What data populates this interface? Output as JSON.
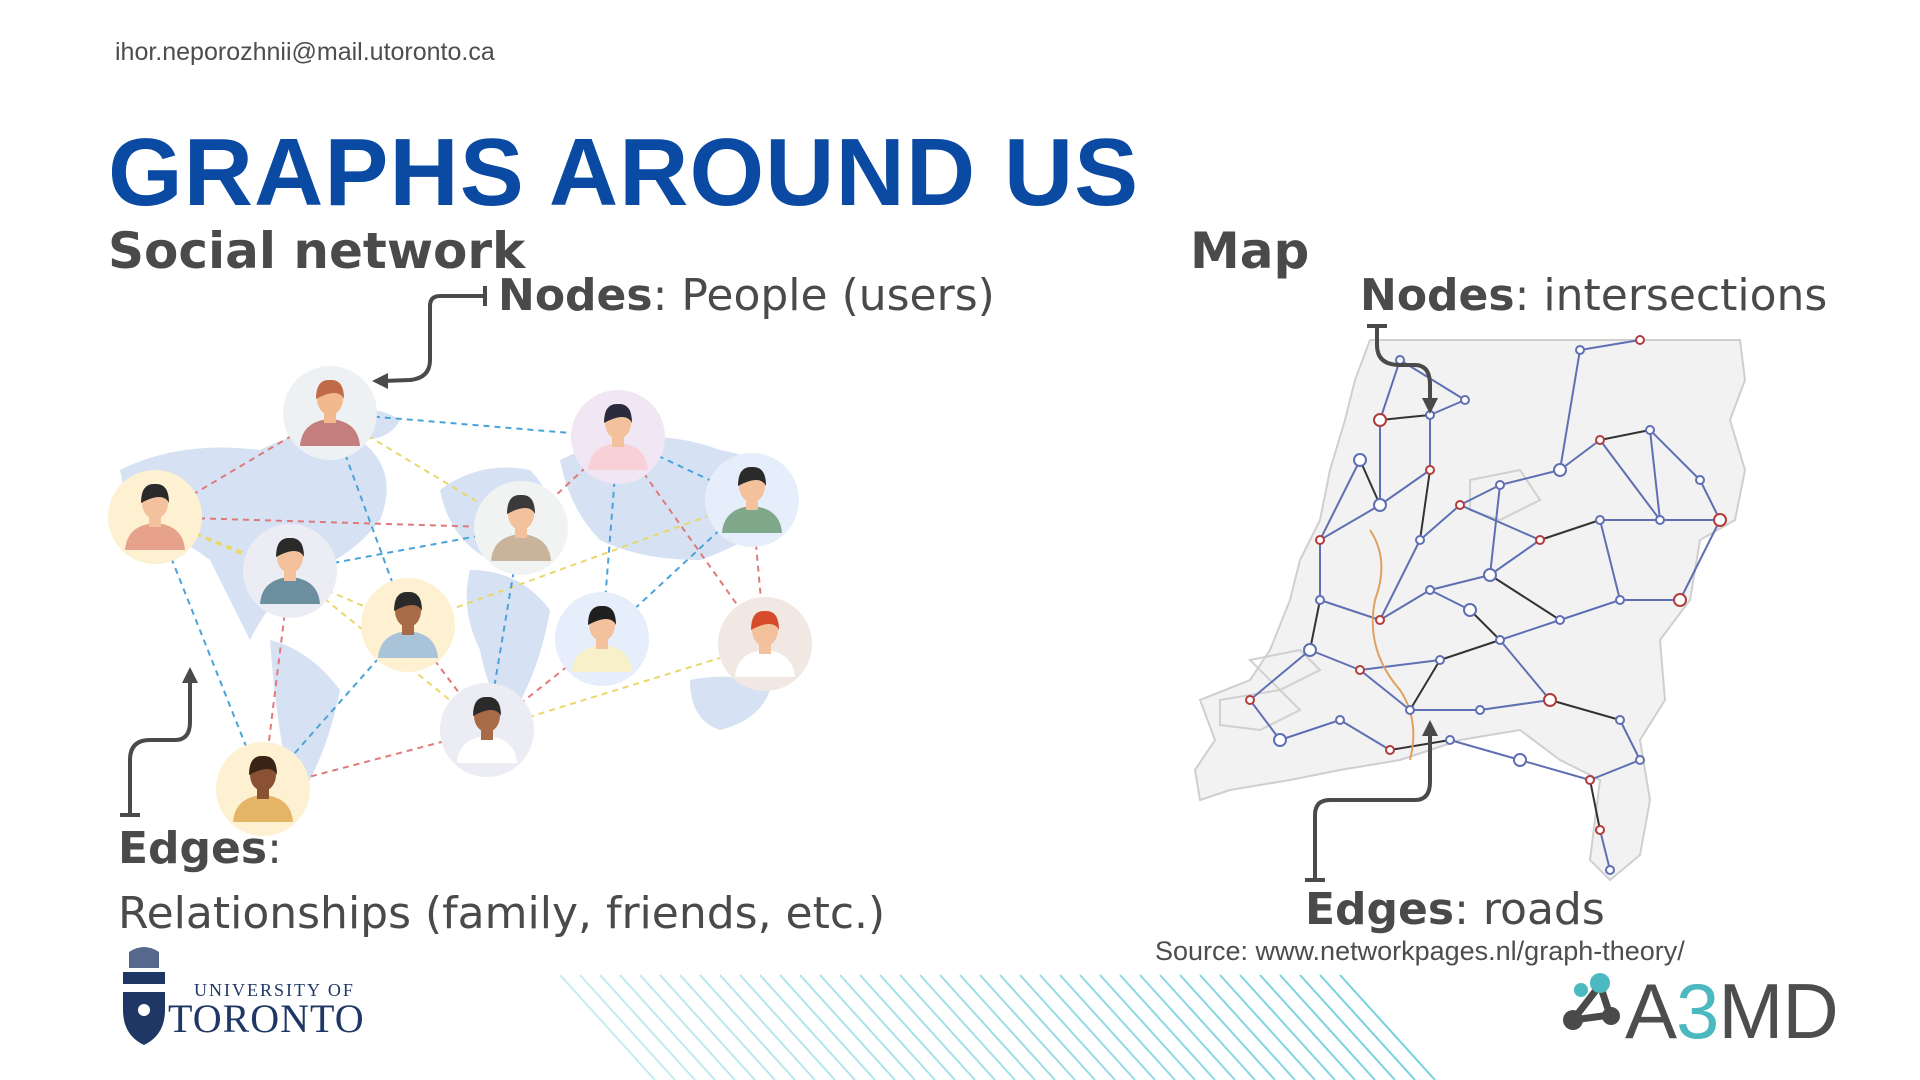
{
  "header": {
    "email": "ihor.neporozhnii@mail.utoronto.ca",
    "title": "GRAPHS AROUND US"
  },
  "social": {
    "heading": "Social network",
    "nodes_term": "Nodes",
    "nodes_desc": ": People (users)",
    "edges_term": "Edges",
    "edges_colon": ":",
    "edges_desc": "Relationships (family, friends, etc.)"
  },
  "map": {
    "heading": "Map",
    "nodes_term": "Nodes",
    "nodes_desc": ": intersections",
    "edges_term": "Edges",
    "edges_desc": ": roads",
    "source": "Source: www.networkpages.nl/graph-theory/"
  },
  "logos": {
    "uoft_line1": "UNIVERSITY OF",
    "uoft_line2": "TORONTO",
    "a3md_prefix": "A",
    "a3md_three": "3",
    "a3md_suffix": "MD"
  },
  "colors": {
    "title": "#0b4aa3",
    "text": "#4a4a4a",
    "accent_teal": "#4bb9bf",
    "uoft_navy": "#1e3765"
  },
  "icons": [
    "arrow-icon",
    "person-avatar-icon",
    "uoft-crest-icon",
    "a3md-molecule-icon"
  ]
}
